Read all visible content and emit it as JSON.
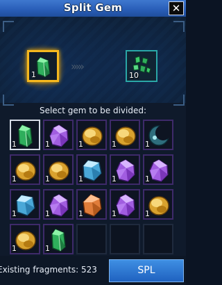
{
  "window": {
    "title": "Split Gem",
    "close_glyph": "✕"
  },
  "split_preview": {
    "source_count": "1",
    "result_count": "10",
    "source_icon": "green-crystal-gem-icon",
    "result_icon": "green-fragments-icon",
    "arrow_glyphs": "›››››"
  },
  "instruction": "Select gem to be divided:",
  "gems": [
    {
      "icon": "green-crystal-gem-icon",
      "count": "1",
      "selected": true
    },
    {
      "icon": "purple-gem-icon",
      "count": "1"
    },
    {
      "icon": "amber-gem-icon",
      "count": "1"
    },
    {
      "icon": "amber-gem-icon",
      "count": "1"
    },
    {
      "icon": "crescent-moon-gem-icon",
      "count": "1"
    },
    {
      "icon": "amber-gem-icon",
      "count": "1"
    },
    {
      "icon": "amber-gem-icon",
      "count": "1"
    },
    {
      "icon": "blue-gem-icon",
      "count": "1"
    },
    {
      "icon": "purple-gem-icon",
      "count": "1"
    },
    {
      "icon": "purple-gem-icon",
      "count": "1"
    },
    {
      "icon": "blue-gem-icon",
      "count": "1"
    },
    {
      "icon": "purple-gem-icon",
      "count": "1"
    },
    {
      "icon": "orange-gem-icon",
      "count": "1"
    },
    {
      "icon": "purple-gem-icon",
      "count": "1"
    },
    {
      "icon": "amber-gem-icon",
      "count": "1"
    },
    {
      "icon": "amber-gem-icon",
      "count": "1"
    },
    {
      "icon": "green-crystal-gem-icon",
      "count": "1"
    }
  ],
  "footer": {
    "fragments_label": "Existing fragments: 523",
    "split_button": "SPL"
  },
  "colors": {
    "accent_gold": "#f6b81e",
    "title_blue": "#2a5fb9",
    "button_blue": "#1f62c0",
    "cell_border_purple": "#3e2a6a"
  }
}
